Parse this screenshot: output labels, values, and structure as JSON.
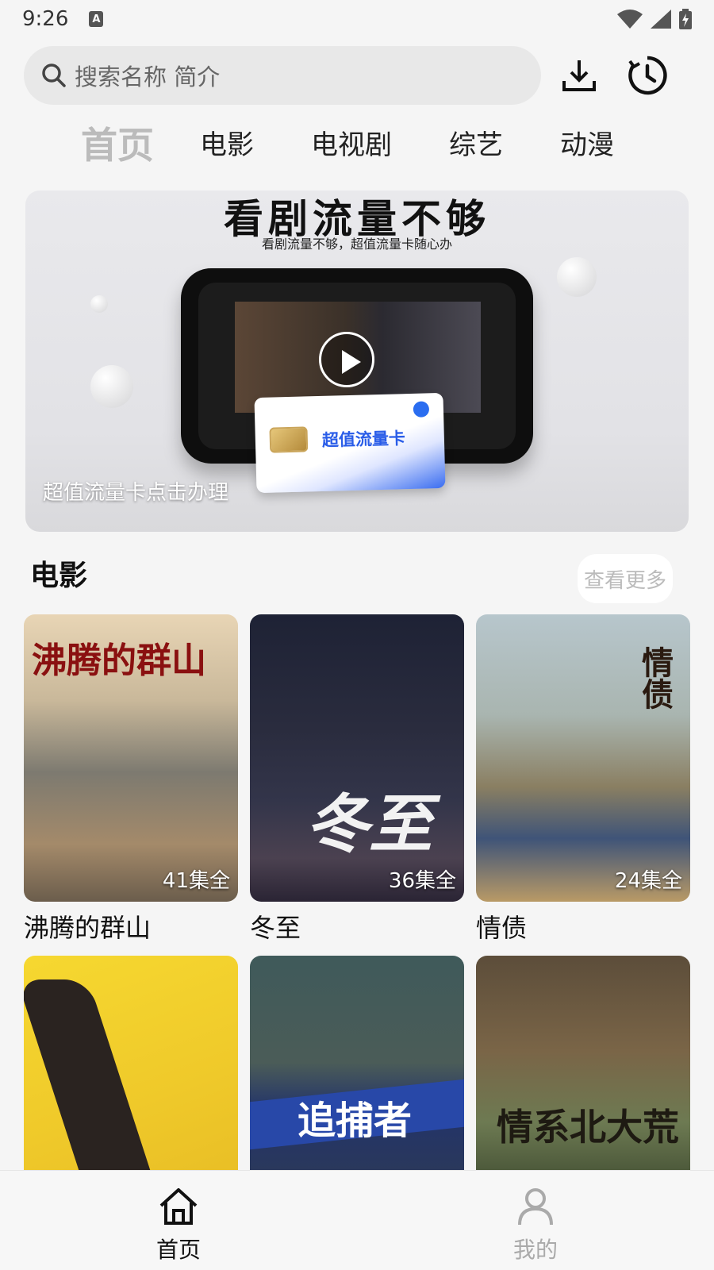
{
  "status": {
    "time": "9:26"
  },
  "search": {
    "placeholder": "搜索名称 简介"
  },
  "tabs": [
    "首页",
    "电影",
    "电视剧",
    "综艺",
    "动漫"
  ],
  "banner": {
    "headline": "看剧流量不够",
    "subtitle": "看剧流量不够，超值流量卡随心办",
    "card_label": "超值流量卡",
    "caption": "超值流量卡点击办理"
  },
  "section": {
    "title": "电影",
    "see_more": "查看更多"
  },
  "movies": [
    {
      "title": "沸腾的群山",
      "episodes": "41集全",
      "poster_text": "沸腾的群山"
    },
    {
      "title": "冬至",
      "episodes": "36集全",
      "poster_text": "冬至"
    },
    {
      "title": "情债",
      "episodes": "24集全",
      "poster_text": "情债"
    },
    {
      "title": "",
      "episodes": "",
      "poster_text": ""
    },
    {
      "title": "",
      "episodes": "",
      "poster_text": "追捕者"
    },
    {
      "title": "",
      "episodes": "",
      "poster_text": "情系北大荒"
    }
  ],
  "bottom_nav": [
    {
      "label": "首页",
      "icon": "home-icon",
      "active": true
    },
    {
      "label": "我的",
      "icon": "user-icon",
      "active": false
    }
  ],
  "colors": {
    "accent_blue": "#2a5de8",
    "active_tab": "#bbbbbb",
    "inactive_nav": "#aaaaaa"
  }
}
